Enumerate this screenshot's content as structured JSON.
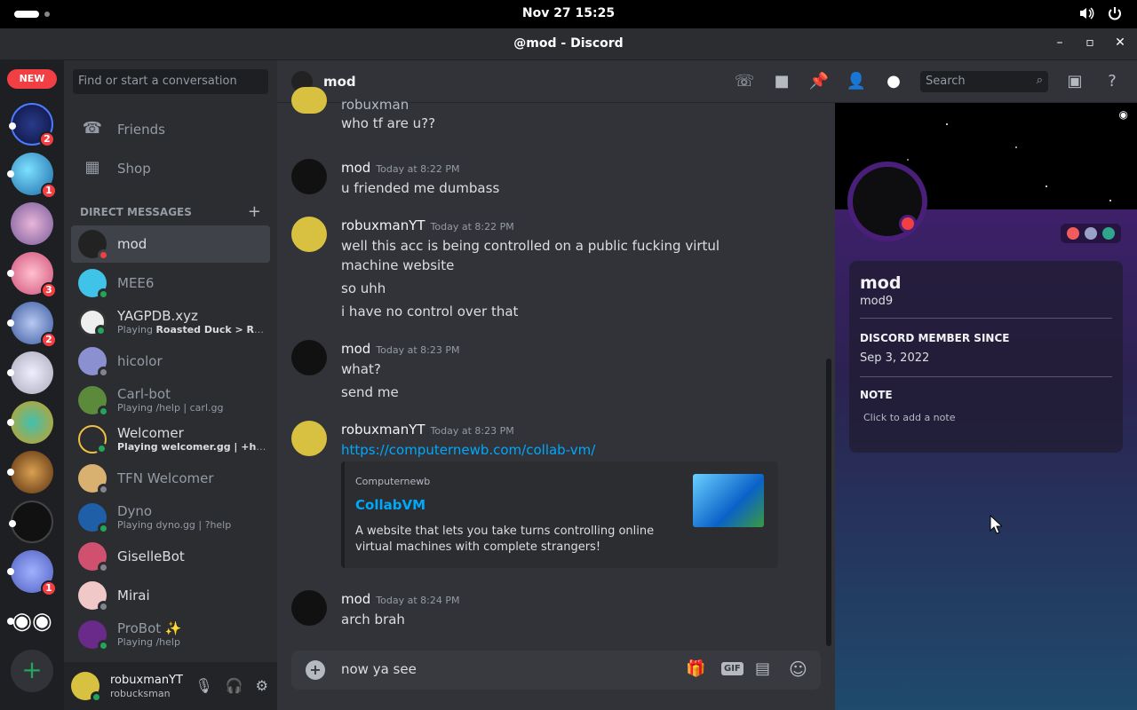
{
  "system": {
    "clock": "Nov 27  15:25"
  },
  "window": {
    "title": "@mod - Discord"
  },
  "guilds": {
    "new_badge": "NEW",
    "badges": [
      "2",
      "1",
      "3",
      "2",
      "1"
    ]
  },
  "dm_pane": {
    "search_placeholder": "Find or start a conversation",
    "nav": {
      "friends": "Friends",
      "shop": "Shop"
    },
    "section_header": "DIRECT MESSAGES",
    "items": [
      {
        "name": "mod",
        "status": "",
        "status_bold": ""
      },
      {
        "name": "MEE6",
        "status": "",
        "status_bold": ""
      },
      {
        "name": "YAGPDB.xyz",
        "status": "Playing ",
        "status_bold": "Roasted Duck > Roast..."
      },
      {
        "name": "hicolor",
        "status": "",
        "status_bold": ""
      },
      {
        "name": "Carl-bot",
        "status": "Playing /help | carl.gg",
        "status_bold": ""
      },
      {
        "name": "Welcomer",
        "status": "Playing ",
        "status_bold": "welcomer.gg | +help"
      },
      {
        "name": "TFN Welcomer",
        "status": "",
        "status_bold": ""
      },
      {
        "name": "Dyno",
        "status": "Playing dyno.gg | ?help",
        "status_bold": ""
      },
      {
        "name": "GiselleBot",
        "status": "",
        "status_bold": ""
      },
      {
        "name": "Mirai",
        "status": "",
        "status_bold": ""
      },
      {
        "name": "ProBot ✨",
        "status": "Playing /help",
        "status_bold": ""
      }
    ]
  },
  "user": {
    "name": "robuxmanYT",
    "tag": "robucksman"
  },
  "chat": {
    "channel": "mod",
    "search_placeholder": "Search",
    "messages": [
      {
        "author": "robuxman",
        "time": "",
        "lines": [
          "who tf are u??"
        ]
      },
      {
        "author": "mod",
        "time": "Today at 8:22 PM",
        "lines": [
          "u friended me dumbass"
        ]
      },
      {
        "author": "robuxmanYT",
        "time": "Today at 8:22 PM",
        "lines": [
          "well this acc is being controlled on a public fucking virtul machine website",
          "so uhh",
          "i have no control over that"
        ]
      },
      {
        "author": "mod",
        "time": "Today at 8:23 PM",
        "lines": [
          "what?",
          "send me"
        ]
      },
      {
        "author": "robuxmanYT",
        "time": "Today at 8:23 PM",
        "link": "https://computernewb.com/collab-vm/"
      },
      {
        "author": "mod",
        "time": "Today at 8:24 PM",
        "lines": [
          "arch brah"
        ]
      }
    ],
    "embed": {
      "provider": "Computernewb",
      "title": "CollabVM",
      "description": "A website that lets you take turns controlling online virtual machines with complete strangers!"
    },
    "composer_value": "now ya see",
    "gif_label": "GIF"
  },
  "profile": {
    "display_name": "mod",
    "username": "mod9",
    "member_since_label": "DISCORD MEMBER SINCE",
    "member_since": "Sep 3, 2022",
    "note_label": "NOTE",
    "note_placeholder": "Click to add a note"
  },
  "colors": {
    "accent": "#5865f2",
    "danger": "#f23f43",
    "online": "#23a55a",
    "link": "#00a8fc"
  }
}
